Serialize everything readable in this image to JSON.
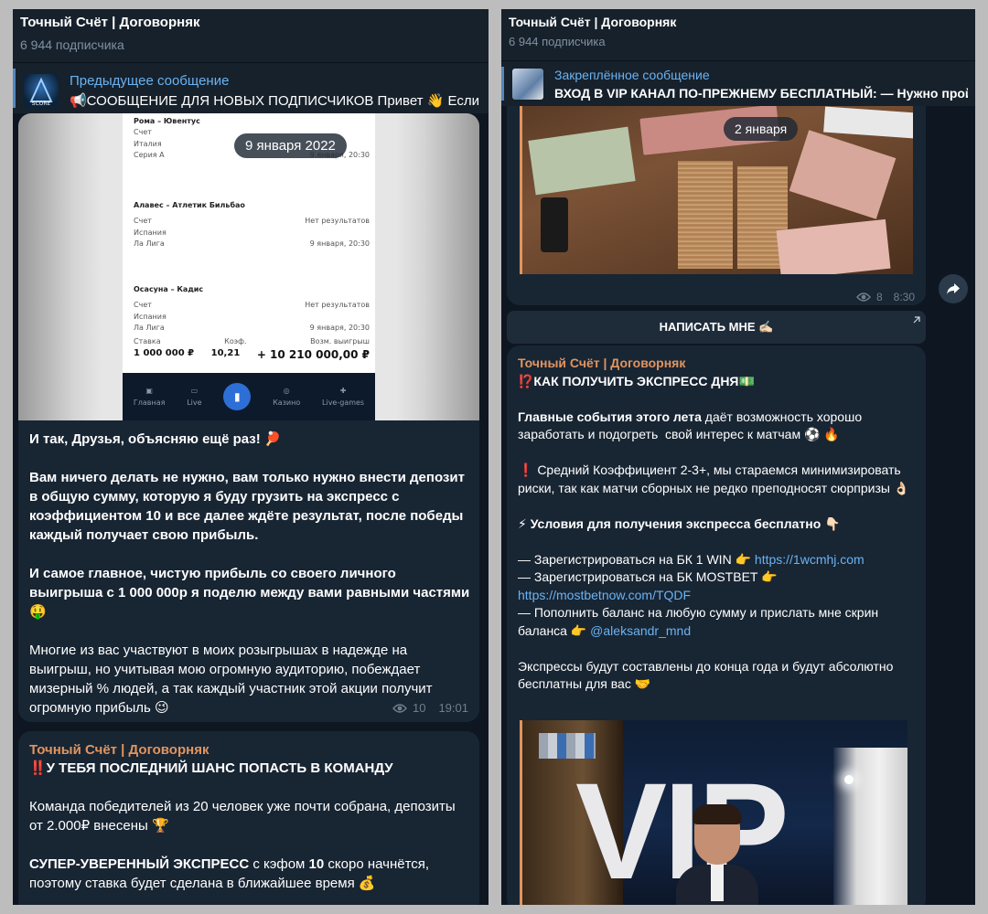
{
  "left": {
    "header": {
      "title": "Точный Счёт | Договорняк",
      "subscribers": "6 944 подписчика"
    },
    "pinned": {
      "label": "Предыдущее сообщение",
      "text": "📢СООБЩЕНИЕ ДЛЯ НОВЫХ ПОДПИСЧИКОВ  Привет 👋 Если"
    },
    "date_pill": "9 января 2022",
    "bets": [
      {
        "match": "Рома – Ювентус",
        "left": "Счет",
        "right": "",
        "country": "Италия",
        "league": "Серия А",
        "date": "9 января, 20:30"
      },
      {
        "match": "Алавес – Атлетик Бильбао",
        "left": "Счет",
        "right": "Нет результатов",
        "country": "Испания",
        "league": "Ла Лига",
        "date": "9 января, 20:30"
      },
      {
        "match": "Осасуна – Кадис",
        "left": "Счет",
        "right": "Нет результатов",
        "country": "Испания",
        "league": "Ла Лига",
        "date": "9 января, 20:30"
      }
    ],
    "bet_summary": {
      "stake_label": "Ставка",
      "stake": "1 000 000 ₽",
      "coef_label": "Коэф.",
      "coef": "10,21",
      "win_label": "Возм. выигрыш",
      "win": "+ 10 210 000,00 ₽"
    },
    "tabs": [
      "Главная",
      "Live",
      "",
      "Казино",
      "Live-games"
    ],
    "message1": {
      "p1": "И так, Друзья, объясняю ещё раз! 🏓",
      "p2": "Вам ничего делать не нужно, вам только нужно внести депозит в общую сумму, которую я буду грузить на экспресс с коэффициентом 10 и все далее ждёте результат, после победы каждый получает свою прибыль.",
      "p3": "И самое главное, чистую прибыль со своего личного выигрыша с 1 000 000р я поделю между вами равными частями 🤑",
      "p4": "Многие из вас участвуют в моих розыгрышах в надежде на выигрыш, но учитывая мою огромную аудиторию, побеждает мизерный % людей, а так каждый участник этой акции получит огромную прибыль 😉",
      "views": "10",
      "time": "19:01"
    },
    "message2": {
      "author": "Точный Счёт | Договорняк",
      "headline": "‼️У ТЕБЯ ПОСЛЕДНИЙ ШАНС ПОПАСТЬ В КОМАНДУ",
      "p1": "Команда победителей из 20 человек уже почти собрана, депозиты от 2.000₽ внесены 🏆",
      "p2_bold": "СУПЕР-УВЕРЕННЫЙ ЭКСПРЕСС",
      "p2_rest": " с кэфом ",
      "p2_coef": "10",
      "p2_end": " скоро начнётся, поэтому ставка будет сделана в ближайшее время 💰"
    }
  },
  "right": {
    "header": {
      "title": "Точный Счёт | Договорняк",
      "subscribers": "6 944 подписчика"
    },
    "pinned": {
      "label": "Закреплённое сообщение",
      "text": "ВХОД  В VIP КАНАЛ ПО-ПРЕЖНЕМУ БЕСПЛАТНЫЙ:  — Нужно пройти"
    },
    "date_pill": "2 января",
    "photo_meta": {
      "views": "8",
      "time": "8:30"
    },
    "write_button": "НАПИСАТЬ МНЕ ✍🏻",
    "post": {
      "author": "Точный Счёт | Договорняк",
      "headline": "⁉️КАК ПОЛУЧИТЬ ЭКСПРЕСС ДНЯ💵",
      "p1_bold": "Главные события этого лета",
      "p1_rest": " даёт возможность хорошо заработать и подогреть  свой интерес к матчам ⚽ 🔥",
      "p2": "❗ Средний Коэффициент 2-3+, мы стараемся минимизировать риски, так как матчи сборных не редко преподносят сюрпризы 👌🏻",
      "p3": "⚡ Условия для получения экспресса бесплатно 👇🏻",
      "c1_text": "— Зарегистрироваться на БК 1 WIN 👉 ",
      "c1_link": "https://1wcmhj.com",
      "c2_text": "— Зарегистрироваться на БК MOSTBET 👉",
      "c2_link": "https://mostbetnow.com/TQDF",
      "c3_text": "— Пополнить баланс на любую сумму и прислать мне скрин баланса 👉 ",
      "c3_link": "@aleksandr_mnd",
      "p4": "Экспрессы будут составлены до конца года и будут абсолютно бесплатны для вас 🤝",
      "vip_text": "VIP"
    }
  },
  "colors": {
    "bg": "#0e1621",
    "bubble": "#182533",
    "link": "#6ab3f3",
    "author": "#e0955f",
    "meta": "#6d7f8f"
  }
}
